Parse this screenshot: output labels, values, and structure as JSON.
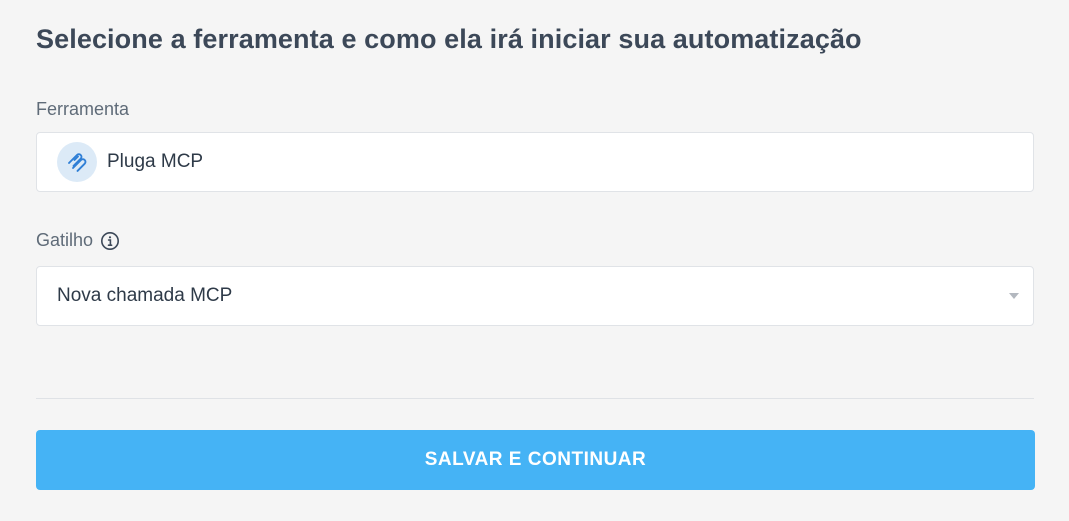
{
  "page": {
    "title": "Selecione a ferramenta e como ela irá iniciar sua automatização"
  },
  "tool": {
    "label": "Ferramenta",
    "value": "Pluga MCP",
    "icon": "pluga-mcp-logo-icon"
  },
  "trigger": {
    "label": "Gatilho",
    "info_icon": "info-icon",
    "selected": "Nova chamada MCP",
    "dropdown_icon": "chevron-down-icon"
  },
  "actions": {
    "save_continue_label": "SALVAR E CONTINUAR"
  },
  "colors": {
    "background": "#f5f5f5",
    "primary_button": "#45b3f5",
    "title_text": "#3c4858",
    "label_text": "#5f6b78",
    "logo_badge": "#dceaf7",
    "logo_accent": "#2f7fd6"
  }
}
